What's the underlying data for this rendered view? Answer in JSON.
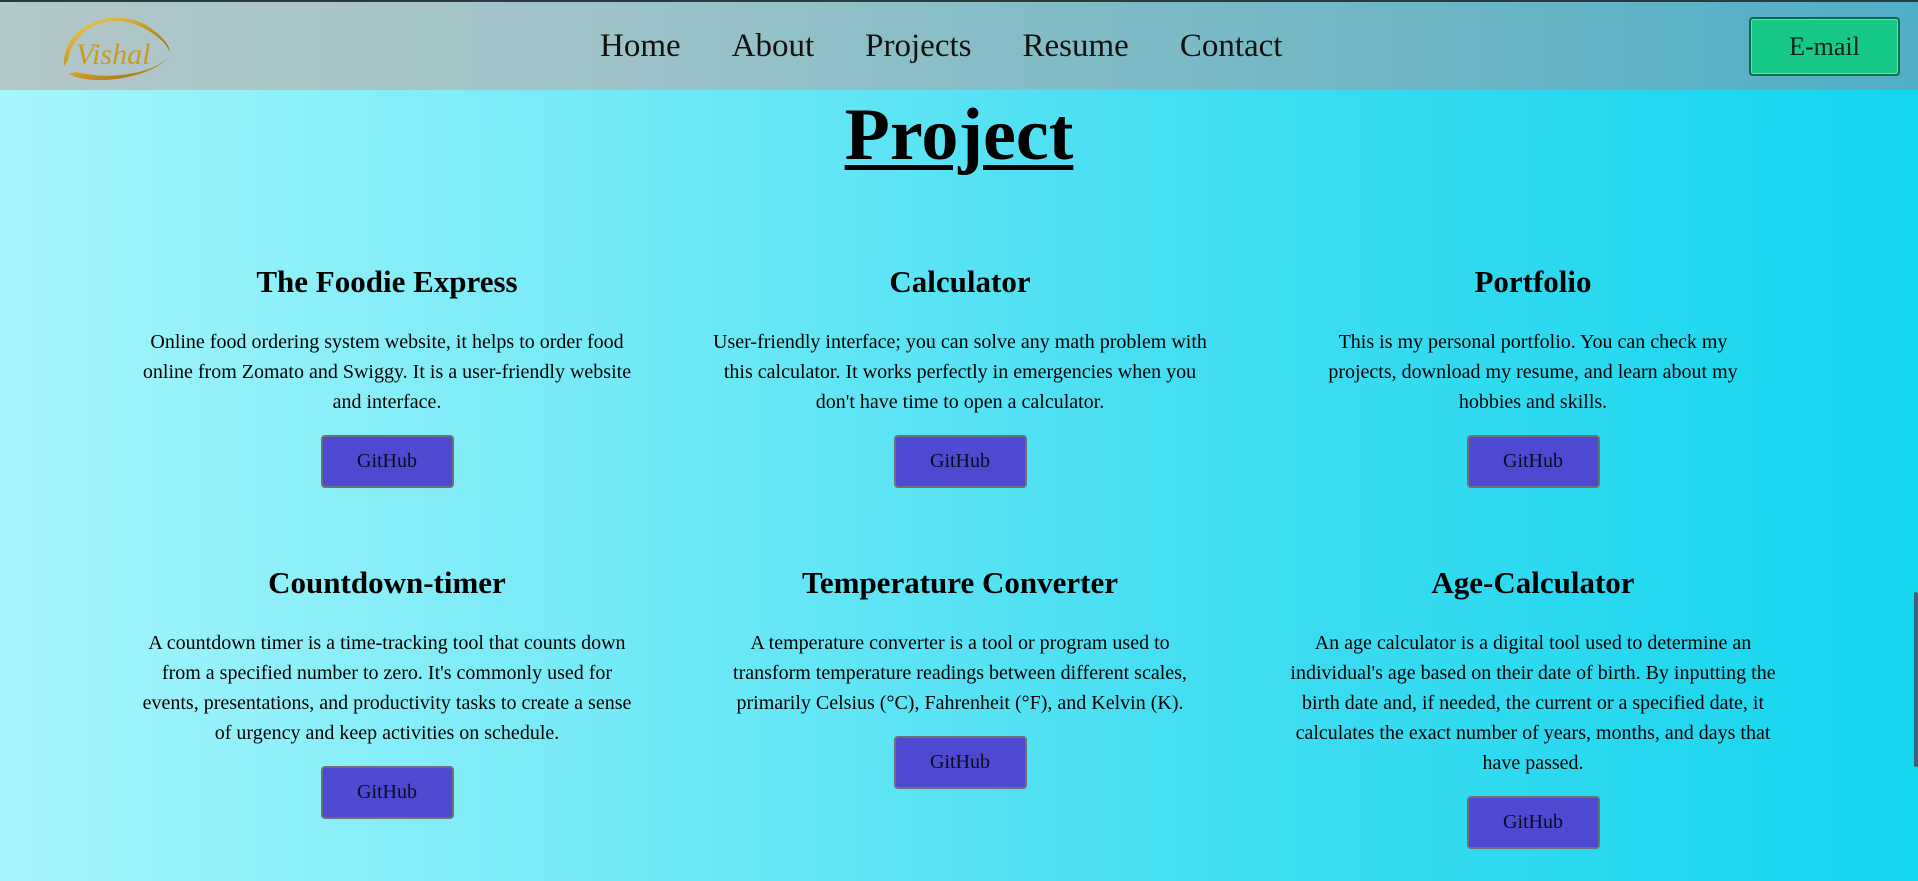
{
  "nav": {
    "logo_text": "Vishal",
    "links": [
      "Home",
      "About",
      "Projects",
      "Resume",
      "Contact"
    ],
    "email_label": "E-mail"
  },
  "page": {
    "title": "Project"
  },
  "projects": [
    {
      "title": "The Foodie Express",
      "description": "Online food ordering system website, it helps to order food online from Zomato and Swiggy. It is a user-friendly website and interface.",
      "button": "GitHub"
    },
    {
      "title": "Calculator",
      "description": "User-friendly interface; you can solve any math problem with this calculator. It works perfectly in emergencies when you don't have time to open a calculator.",
      "button": "GitHub"
    },
    {
      "title": "Portfolio",
      "description": "This is my personal portfolio. You can check my projects, download my resume, and learn about my hobbies and skills.",
      "button": "GitHub"
    },
    {
      "title": "Countdown-timer",
      "description": "A countdown timer is a time-tracking tool that counts down from a specified number to zero. It's commonly used for events, presentations, and productivity tasks to create a sense of urgency and keep activities on schedule.",
      "button": "GitHub"
    },
    {
      "title": "Temperature Converter",
      "description": "A temperature converter is a tool or program used to transform temperature readings between different scales, primarily Celsius (°C), Fahrenheit (°F), and Kelvin (K).",
      "button": "GitHub"
    },
    {
      "title": "Age-Calculator",
      "description": "An age calculator is a digital tool used to determine an individual's age based on their date of birth. By inputting the birth date and, if needed, the current or a specified date, it calculates the exact number of years, months, and days that have passed.",
      "button": "GitHub"
    }
  ],
  "colors": {
    "email_button": "#16c987",
    "github_button": "#4d49d0"
  }
}
